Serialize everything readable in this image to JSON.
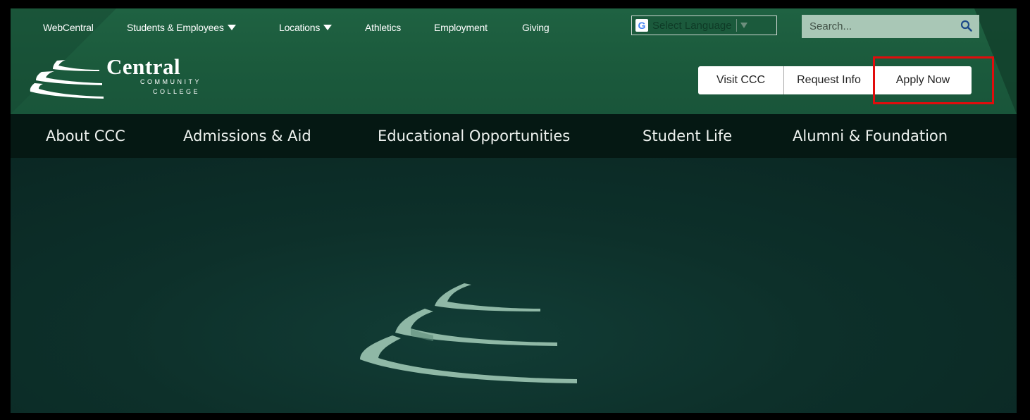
{
  "utility_nav": {
    "links": [
      "WebCentral",
      "Students & Employees",
      "Locations",
      "Athletics",
      "Employment",
      "Giving"
    ]
  },
  "language": {
    "label": "Select Language",
    "icon": "google-g-icon"
  },
  "search": {
    "placeholder": "Search..."
  },
  "logo": {
    "word": "Central",
    "line1": "COMMUNITY",
    "line2": "COLLEGE"
  },
  "cta": {
    "visit": "Visit CCC",
    "request": "Request Info",
    "apply": "Apply Now"
  },
  "main_nav": [
    "About CCC",
    "Admissions & Aid",
    "Educational Opportunities",
    "Student Life",
    "Alumni & Foundation"
  ],
  "colors": {
    "header_green": "#1f6242",
    "nav_dark": "#051813",
    "hero_dark": "#0c2c28",
    "search_bg": "#a9c7b6",
    "highlight_red": "#e10c0c"
  }
}
